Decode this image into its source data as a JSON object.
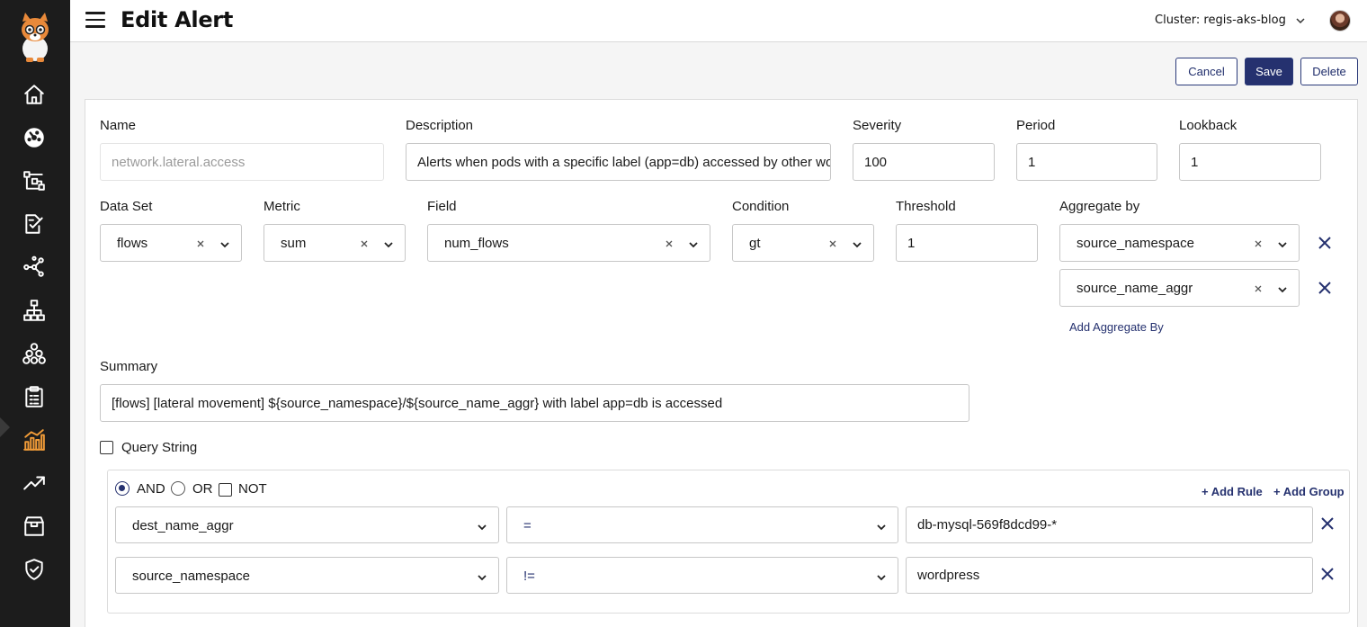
{
  "header": {
    "title": "Edit Alert",
    "cluster_label": "Cluster: regis-aks-blog"
  },
  "sidebar": {
    "items": [
      {
        "icon": "home-icon"
      },
      {
        "icon": "dashboard-icon"
      },
      {
        "icon": "flow-icon"
      },
      {
        "icon": "policies-icon"
      },
      {
        "icon": "graph-icon"
      },
      {
        "icon": "hierarchy-icon"
      },
      {
        "icon": "nodes-icon"
      },
      {
        "icon": "clipboard-icon"
      },
      {
        "icon": "alerts-chart-icon",
        "active": true
      },
      {
        "icon": "trending-icon"
      },
      {
        "icon": "box-icon"
      },
      {
        "icon": "shield-icon"
      }
    ],
    "accent": "#f29c38"
  },
  "actions": {
    "cancel": "Cancel",
    "save": "Save",
    "delete": "Delete"
  },
  "form": {
    "name": {
      "label": "Name",
      "placeholder": "network.lateral.access"
    },
    "description": {
      "label": "Description",
      "value": "Alerts when pods with a specific label (app=db) accessed by other workloads within the cluster"
    },
    "severity": {
      "label": "Severity",
      "value": "100"
    },
    "period": {
      "label": "Period",
      "value": "1"
    },
    "lookback": {
      "label": "Lookback",
      "value": "1"
    },
    "dataset": {
      "label": "Data Set",
      "value": "flows"
    },
    "metric": {
      "label": "Metric",
      "value": "sum"
    },
    "field": {
      "label": "Field",
      "value": "num_flows"
    },
    "condition": {
      "label": "Condition",
      "value": "gt"
    },
    "threshold": {
      "label": "Threshold",
      "value": "1"
    },
    "aggregate_by": {
      "label": "Aggregate by",
      "values": [
        "source_namespace",
        "source_name_aggr"
      ],
      "add_label": "Add Aggregate By"
    },
    "summary": {
      "label": "Summary",
      "value": "[flows] [lateral movement] ${source_namespace}/${source_name_aggr} with label app=db is accessed"
    },
    "query_string": {
      "label": "Query String",
      "checked": false
    }
  },
  "query_group": {
    "and_label": "AND",
    "or_label": "OR",
    "not_label": "NOT",
    "selected": "AND",
    "add_rule": "+ Add Rule",
    "add_group": "+ Add Group",
    "rules": [
      {
        "field": "dest_name_aggr",
        "operator": "=",
        "value": "db-mysql-569f8dcd99-*"
      },
      {
        "field": "source_namespace",
        "operator": "!=",
        "value": "wordpress"
      }
    ]
  },
  "colors": {
    "primary": "#25316f",
    "sidebar_bg": "#1c1c1c"
  }
}
